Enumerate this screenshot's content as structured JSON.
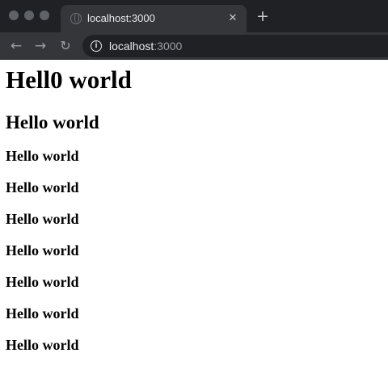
{
  "browser": {
    "tab": {
      "favicon": "globe-icon",
      "title": "localhost:3000",
      "close_glyph": "✕"
    },
    "new_tab_glyph": "+",
    "nav": {
      "back_glyph": "←",
      "forward_glyph": "→",
      "reload_glyph": "↻"
    },
    "address_bar": {
      "icon": "info-icon",
      "icon_glyph": "i",
      "host": "localhost",
      "port": ":3000"
    },
    "colors": {
      "titlebar": "#202124",
      "toolbar": "#35363a",
      "omnibox": "#202124"
    }
  },
  "page": {
    "h1": "Hell0 world",
    "h2": "Hello world",
    "h3_items": [
      "Hello world",
      "Hello world",
      "Hello world",
      "Hello world",
      "Hello world",
      "Hello world",
      "Hello world"
    ]
  }
}
